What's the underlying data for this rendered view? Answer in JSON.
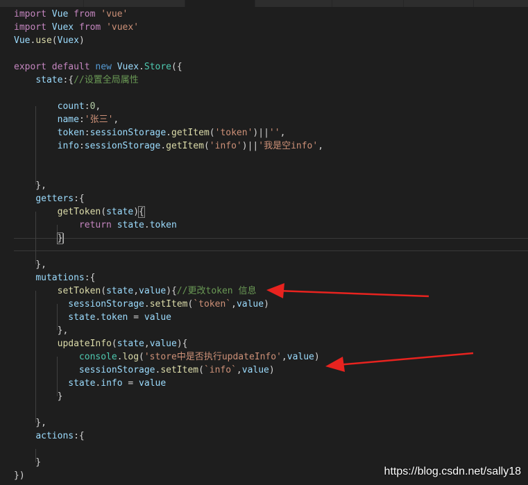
{
  "editor": {
    "lines": [
      [
        {
          "t": "import",
          "c": "kw2"
        },
        {
          "t": " "
        },
        {
          "t": "Vue",
          "c": "prop"
        },
        {
          "t": " "
        },
        {
          "t": "from",
          "c": "kw2"
        },
        {
          "t": " "
        },
        {
          "t": "'vue'",
          "c": "str"
        }
      ],
      [
        {
          "t": "import",
          "c": "kw2"
        },
        {
          "t": " "
        },
        {
          "t": "Vuex",
          "c": "prop"
        },
        {
          "t": " "
        },
        {
          "t": "from",
          "c": "kw2"
        },
        {
          "t": " "
        },
        {
          "t": "'vuex'",
          "c": "str"
        }
      ],
      [
        {
          "t": "Vue",
          "c": "prop"
        },
        {
          "t": "."
        },
        {
          "t": "use",
          "c": "fn"
        },
        {
          "t": "("
        },
        {
          "t": "Vuex",
          "c": "prop"
        },
        {
          "t": ")"
        }
      ],
      [],
      [
        {
          "t": "export",
          "c": "kw2"
        },
        {
          "t": " "
        },
        {
          "t": "default",
          "c": "kw2"
        },
        {
          "t": " "
        },
        {
          "t": "new",
          "c": "kw"
        },
        {
          "t": " "
        },
        {
          "t": "Vuex",
          "c": "prop"
        },
        {
          "t": "."
        },
        {
          "t": "Store",
          "c": "cls"
        },
        {
          "t": "({"
        }
      ],
      [
        {
          "t": "    "
        },
        {
          "t": "state",
          "c": "prop"
        },
        {
          "t": ":{"
        },
        {
          "t": "//设置全局属性",
          "c": "cm"
        }
      ],
      [],
      [
        {
          "t": "        "
        },
        {
          "t": "count",
          "c": "prop"
        },
        {
          "t": ":"
        },
        {
          "t": "0",
          "c": "num"
        },
        {
          "t": ","
        }
      ],
      [
        {
          "t": "        "
        },
        {
          "t": "name",
          "c": "prop"
        },
        {
          "t": ":"
        },
        {
          "t": "'张三'",
          "c": "str"
        },
        {
          "t": ","
        }
      ],
      [
        {
          "t": "        "
        },
        {
          "t": "token",
          "c": "prop"
        },
        {
          "t": ":"
        },
        {
          "t": "sessionStorage",
          "c": "prop"
        },
        {
          "t": "."
        },
        {
          "t": "getItem",
          "c": "fn"
        },
        {
          "t": "("
        },
        {
          "t": "'token'",
          "c": "str"
        },
        {
          "t": ")||"
        },
        {
          "t": "''",
          "c": "str"
        },
        {
          "t": ","
        }
      ],
      [
        {
          "t": "        "
        },
        {
          "t": "info",
          "c": "prop"
        },
        {
          "t": ":"
        },
        {
          "t": "sessionStorage",
          "c": "prop"
        },
        {
          "t": "."
        },
        {
          "t": "getItem",
          "c": "fn"
        },
        {
          "t": "("
        },
        {
          "t": "'info'",
          "c": "str"
        },
        {
          "t": ")||"
        },
        {
          "t": "'我是空info'",
          "c": "str"
        },
        {
          "t": ","
        }
      ],
      [],
      [],
      [
        {
          "t": "    },"
        }
      ],
      [
        {
          "t": "    "
        },
        {
          "t": "getters",
          "c": "prop"
        },
        {
          "t": ":{"
        }
      ],
      [
        {
          "t": "        "
        },
        {
          "t": "getToken",
          "c": "fn"
        },
        {
          "t": "("
        },
        {
          "t": "state",
          "c": "prop"
        },
        {
          "t": ")"
        },
        {
          "t": "{",
          "c": "bm"
        }
      ],
      [
        {
          "t": "            "
        },
        {
          "t": "return",
          "c": "kw2"
        },
        {
          "t": " "
        },
        {
          "t": "state",
          "c": "prop"
        },
        {
          "t": "."
        },
        {
          "t": "token",
          "c": "prop"
        }
      ],
      [
        {
          "t": "        "
        },
        {
          "t": "}",
          "c": "bm"
        },
        {
          "t": "",
          "c": "cursor"
        }
      ],
      [],
      [
        {
          "t": "    },"
        }
      ],
      [
        {
          "t": "    "
        },
        {
          "t": "mutations",
          "c": "prop"
        },
        {
          "t": ":{"
        }
      ],
      [
        {
          "t": "        "
        },
        {
          "t": "setToken",
          "c": "fn"
        },
        {
          "t": "("
        },
        {
          "t": "state",
          "c": "prop"
        },
        {
          "t": ","
        },
        {
          "t": "value",
          "c": "prop"
        },
        {
          "t": "){"
        },
        {
          "t": "//更改token 信息",
          "c": "cm"
        }
      ],
      [
        {
          "t": "          "
        },
        {
          "t": "sessionStorage",
          "c": "prop"
        },
        {
          "t": "."
        },
        {
          "t": "setItem",
          "c": "fn"
        },
        {
          "t": "("
        },
        {
          "t": "`token`",
          "c": "str"
        },
        {
          "t": ","
        },
        {
          "t": "value",
          "c": "prop"
        },
        {
          "t": ")"
        }
      ],
      [
        {
          "t": "          "
        },
        {
          "t": "state",
          "c": "prop"
        },
        {
          "t": "."
        },
        {
          "t": "token",
          "c": "prop"
        },
        {
          "t": " = "
        },
        {
          "t": "value",
          "c": "prop"
        }
      ],
      [
        {
          "t": "        },"
        }
      ],
      [
        {
          "t": "        "
        },
        {
          "t": "updateInfo",
          "c": "fn"
        },
        {
          "t": "("
        },
        {
          "t": "state",
          "c": "prop"
        },
        {
          "t": ","
        },
        {
          "t": "value",
          "c": "prop"
        },
        {
          "t": "){"
        }
      ],
      [
        {
          "t": "            "
        },
        {
          "t": "console",
          "c": "cls"
        },
        {
          "t": "."
        },
        {
          "t": "log",
          "c": "fn"
        },
        {
          "t": "("
        },
        {
          "t": "'store中是否执行updateInfo'",
          "c": "str"
        },
        {
          "t": ","
        },
        {
          "t": "value",
          "c": "prop"
        },
        {
          "t": ")"
        }
      ],
      [
        {
          "t": "            "
        },
        {
          "t": "sessionStorage",
          "c": "prop"
        },
        {
          "t": "."
        },
        {
          "t": "setItem",
          "c": "fn"
        },
        {
          "t": "("
        },
        {
          "t": "`info`",
          "c": "str"
        },
        {
          "t": ","
        },
        {
          "t": "value",
          "c": "prop"
        },
        {
          "t": ")"
        }
      ],
      [
        {
          "t": "          "
        },
        {
          "t": "state",
          "c": "prop"
        },
        {
          "t": "."
        },
        {
          "t": "info",
          "c": "prop"
        },
        {
          "t": " = "
        },
        {
          "t": "value",
          "c": "prop"
        }
      ],
      [
        {
          "t": "        }"
        }
      ],
      [],
      [
        {
          "t": "    },"
        }
      ],
      [
        {
          "t": "    "
        },
        {
          "t": "actions",
          "c": "prop"
        },
        {
          "t": ":{"
        }
      ],
      [],
      [
        {
          "t": "    }"
        }
      ],
      [
        {
          "t": "})"
        }
      ]
    ]
  },
  "watermark": "https://blog.csdn.net/sally18",
  "colors": {
    "background": "#1e1e1e",
    "arrow": "#e8231f"
  }
}
